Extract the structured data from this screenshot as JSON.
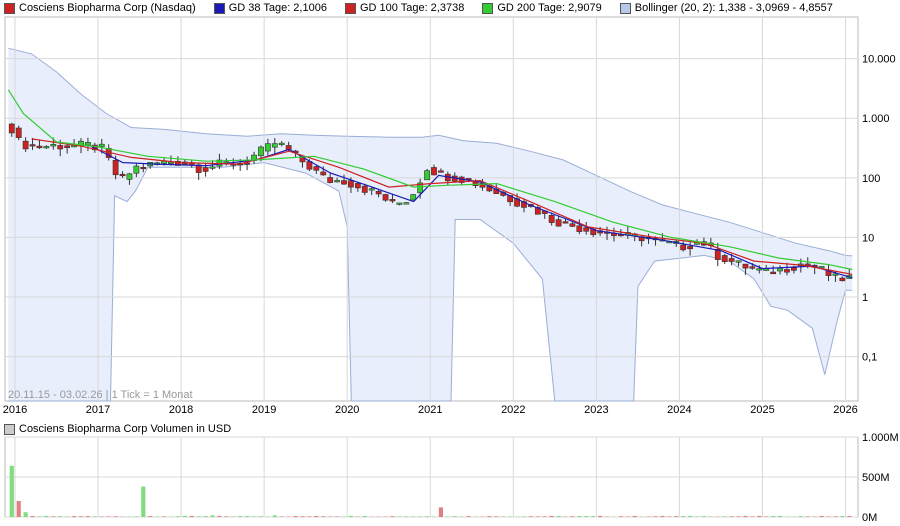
{
  "legend": {
    "title": "Cosciens Biopharma Corp (Nasdaq)",
    "items": [
      {
        "label": "GD 38 Tage: 2,1006",
        "color": "#1a1ab8"
      },
      {
        "label": "GD 100 Tage: 2,3738",
        "color": "#cc2222"
      },
      {
        "label": "GD 200 Tage: 2,9079",
        "color": "#33cc33"
      },
      {
        "label": "Bollinger (20, 2): 1,338 - 3,0969 - 4,8557",
        "color": "#b8c8e8"
      }
    ]
  },
  "volume_title": "Cosciens Biopharma Corp Volumen in USD",
  "range_info": "20.11.15 - 03.02.26",
  "tick_info": "1 Tick = 1 Monat",
  "colors": {
    "up": "#33cc33",
    "down": "#cc2222",
    "band": "#e8eefb",
    "band_line": "#9aaed6",
    "grid": "#d8d8d8"
  },
  "chart_data": [
    {
      "type": "candlestick",
      "scale": "log",
      "x_ticks": [
        "2016",
        "2017",
        "2018",
        "2019",
        "2020",
        "2021",
        "2022",
        "2023",
        "2024",
        "2025",
        "2026"
      ],
      "y_ticks": [
        {
          "value": 0.1,
          "label": "0,1"
        },
        {
          "value": 1,
          "label": "1"
        },
        {
          "value": 10,
          "label": "10"
        },
        {
          "value": 100,
          "label": "100"
        },
        {
          "value": 1000,
          "label": "1.000"
        },
        {
          "value": 10000,
          "label": "10.000"
        }
      ],
      "ylim": [
        0.018,
        50000
      ],
      "xlim": [
        2015.88,
        2026.15
      ],
      "price_points": [
        [
          2015.92,
          800
        ],
        [
          2016.0,
          700
        ],
        [
          2016.1,
          380
        ],
        [
          2016.3,
          330
        ],
        [
          2016.5,
          350
        ],
        [
          2016.7,
          340
        ],
        [
          2016.9,
          360
        ],
        [
          2017.1,
          310
        ],
        [
          2017.3,
          85
        ],
        [
          2017.5,
          150
        ],
        [
          2017.7,
          170
        ],
        [
          2017.9,
          190
        ],
        [
          2018.1,
          180
        ],
        [
          2018.3,
          140
        ],
        [
          2018.5,
          170
        ],
        [
          2018.8,
          180
        ],
        [
          2019.0,
          280
        ],
        [
          2019.2,
          400
        ],
        [
          2019.4,
          240
        ],
        [
          2019.6,
          150
        ],
        [
          2019.8,
          90
        ],
        [
          2020.0,
          90
        ],
        [
          2020.2,
          70
        ],
        [
          2020.4,
          55
        ],
        [
          2020.6,
          35
        ],
        [
          2020.8,
          45
        ],
        [
          2021.0,
          150
        ],
        [
          2021.2,
          110
        ],
        [
          2021.4,
          100
        ],
        [
          2021.6,
          80
        ],
        [
          2021.8,
          60
        ],
        [
          2022.0,
          45
        ],
        [
          2022.3,
          30
        ],
        [
          2022.5,
          20
        ],
        [
          2022.8,
          15
        ],
        [
          2023.0,
          13
        ],
        [
          2023.3,
          11
        ],
        [
          2023.6,
          10
        ],
        [
          2023.9,
          8
        ],
        [
          2024.1,
          7
        ],
        [
          2024.3,
          9
        ],
        [
          2024.5,
          5
        ],
        [
          2024.7,
          3.8
        ],
        [
          2024.9,
          3
        ],
        [
          2025.1,
          2.6
        ],
        [
          2025.3,
          3
        ],
        [
          2025.5,
          3.6
        ],
        [
          2025.7,
          3.2
        ],
        [
          2025.85,
          2.3
        ],
        [
          2025.95,
          2.0
        ],
        [
          2026.08,
          2.1
        ]
      ],
      "moving_averages": [
        {
          "name": "GD 38 Tage",
          "color": "#1a1ab8",
          "points": [
            [
              2016.9,
              350
            ],
            [
              2017.3,
              180
            ],
            [
              2017.7,
              170
            ],
            [
              2018.3,
              160
            ],
            [
              2018.9,
              200
            ],
            [
              2019.3,
              300
            ],
            [
              2019.8,
              120
            ],
            [
              2020.3,
              70
            ],
            [
              2020.8,
              40
            ],
            [
              2021.1,
              110
            ],
            [
              2021.6,
              85
            ],
            [
              2022.2,
              35
            ],
            [
              2023.0,
              13
            ],
            [
              2023.8,
              9
            ],
            [
              2024.5,
              6
            ],
            [
              2025.0,
              3
            ],
            [
              2025.6,
              3.3
            ],
            [
              2026.08,
              2.1
            ]
          ]
        },
        {
          "name": "GD 100 Tage",
          "color": "#cc2222",
          "points": [
            [
              2016.2,
              450
            ],
            [
              2016.8,
              340
            ],
            [
              2017.4,
              220
            ],
            [
              2018.0,
              180
            ],
            [
              2018.7,
              170
            ],
            [
              2019.3,
              280
            ],
            [
              2019.9,
              150
            ],
            [
              2020.5,
              70
            ],
            [
              2021.0,
              80
            ],
            [
              2021.6,
              90
            ],
            [
              2022.2,
              40
            ],
            [
              2022.9,
              15
            ],
            [
              2023.7,
              10
            ],
            [
              2024.3,
              8
            ],
            [
              2024.9,
              4
            ],
            [
              2025.5,
              3.4
            ],
            [
              2026.08,
              2.4
            ]
          ]
        },
        {
          "name": "GD 200 Tage",
          "color": "#33cc33",
          "points": [
            [
              2015.92,
              3000
            ],
            [
              2016.1,
              1200
            ],
            [
              2016.5,
              400
            ],
            [
              2017.0,
              330
            ],
            [
              2017.6,
              230
            ],
            [
              2018.3,
              190
            ],
            [
              2018.9,
              200
            ],
            [
              2019.6,
              230
            ],
            [
              2020.2,
              140
            ],
            [
              2020.8,
              70
            ],
            [
              2021.2,
              75
            ],
            [
              2021.8,
              80
            ],
            [
              2022.5,
              40
            ],
            [
              2023.2,
              18
            ],
            [
              2023.9,
              10
            ],
            [
              2024.6,
              7
            ],
            [
              2025.2,
              4.5
            ],
            [
              2025.8,
              3.5
            ],
            [
              2026.08,
              2.9
            ]
          ]
        }
      ],
      "bollinger_upper": [
        [
          2015.92,
          15000
        ],
        [
          2016.2,
          12000
        ],
        [
          2016.5,
          6000
        ],
        [
          2016.8,
          2500
        ],
        [
          2017.1,
          1200
        ],
        [
          2017.4,
          700
        ],
        [
          2017.8,
          650
        ],
        [
          2018.3,
          550
        ],
        [
          2018.8,
          500
        ],
        [
          2019.2,
          550
        ],
        [
          2019.6,
          520
        ],
        [
          2020.0,
          500
        ],
        [
          2020.5,
          480
        ],
        [
          2020.9,
          480
        ],
        [
          2021.1,
          520
        ],
        [
          2021.4,
          420
        ],
        [
          2021.8,
          380
        ],
        [
          2022.2,
          280
        ],
        [
          2022.6,
          200
        ],
        [
          2023.0,
          110
        ],
        [
          2023.4,
          60
        ],
        [
          2023.8,
          35
        ],
        [
          2024.2,
          25
        ],
        [
          2024.6,
          18
        ],
        [
          2025.0,
          12
        ],
        [
          2025.4,
          8
        ],
        [
          2025.8,
          6
        ],
        [
          2026.0,
          5
        ],
        [
          2026.08,
          4.9
        ]
      ],
      "bollinger_lower": [
        [
          2015.92,
          0.018
        ],
        [
          2017.15,
          0.018
        ],
        [
          2017.2,
          50
        ],
        [
          2017.35,
          40
        ],
        [
          2017.45,
          60
        ],
        [
          2017.6,
          150
        ],
        [
          2018.5,
          150
        ],
        [
          2019.0,
          180
        ],
        [
          2019.5,
          120
        ],
        [
          2019.9,
          60
        ],
        [
          2020.0,
          15
        ],
        [
          2020.05,
          0.018
        ],
        [
          2021.25,
          0.018
        ],
        [
          2021.3,
          20
        ],
        [
          2021.6,
          20
        ],
        [
          2022.0,
          8
        ],
        [
          2022.35,
          2
        ],
        [
          2022.5,
          0.018
        ],
        [
          2023.45,
          0.018
        ],
        [
          2023.5,
          1.5
        ],
        [
          2023.7,
          4
        ],
        [
          2024.3,
          5
        ],
        [
          2024.6,
          4
        ],
        [
          2024.9,
          2
        ],
        [
          2025.1,
          0.7
        ],
        [
          2025.3,
          0.6
        ],
        [
          2025.6,
          0.3
        ],
        [
          2025.75,
          0.05
        ],
        [
          2025.9,
          0.4
        ],
        [
          2026.0,
          1.3
        ],
        [
          2026.08,
          1.3
        ]
      ]
    },
    {
      "type": "bar",
      "title": "Cosciens Biopharma Corp Volumen in USD",
      "y_ticks": [
        {
          "value": 0,
          "label": "0M"
        },
        {
          "value": 500,
          "label": "500M"
        },
        {
          "value": 1000,
          "label": "1.000M"
        }
      ],
      "ylim": [
        0,
        1000
      ],
      "volume_spikes": [
        [
          2015.95,
          640
        ],
        [
          2016.02,
          200
        ],
        [
          2016.1,
          60
        ],
        [
          2017.5,
          380
        ],
        [
          2021.1,
          120
        ],
        [
          2018.3,
          20
        ],
        [
          2019.1,
          20
        ],
        [
          2020.0,
          15
        ]
      ]
    }
  ]
}
